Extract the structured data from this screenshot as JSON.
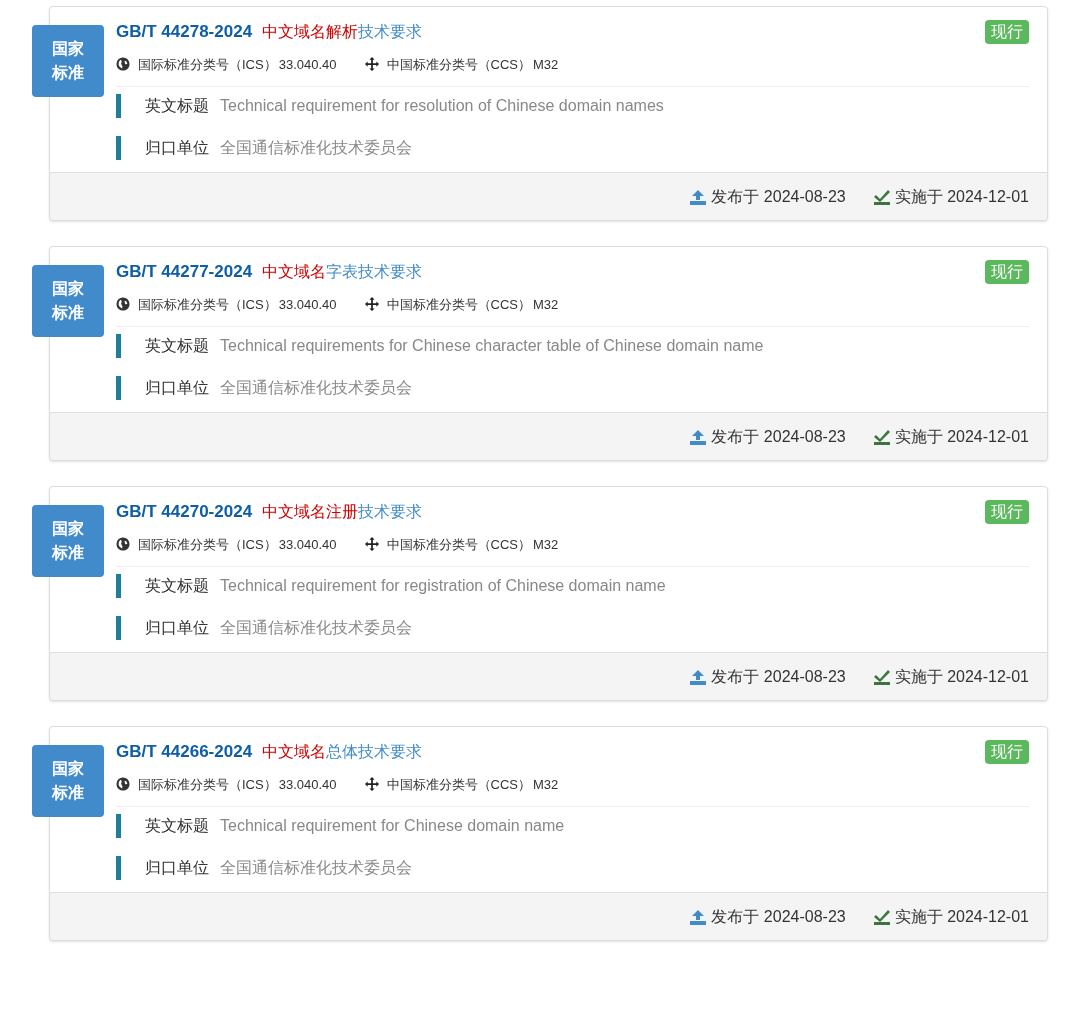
{
  "standards": [
    {
      "badge": [
        "国家",
        "标准"
      ],
      "code": "GB/T 44278-2024",
      "title_highlight": "中文域名解析",
      "title_rest": "技术要求",
      "status": "现行",
      "ics_label": "国际标准分类号（ICS）",
      "ics": "33.040.40",
      "ccs_label": "中国标准分类号（CCS）",
      "ccs": "M32",
      "fields": [
        {
          "label": "英文标题",
          "value": "Technical requirement for resolution of Chinese domain names"
        },
        {
          "label": "归口单位",
          "value": "全国通信标准化技术委员会"
        }
      ],
      "published": "发布于 2024-08-23",
      "effective": "实施于 2024-12-01"
    },
    {
      "badge": [
        "国家",
        "标准"
      ],
      "code": "GB/T 44277-2024",
      "title_highlight": "中文域名",
      "title_rest": "字表技术要求",
      "status": "现行",
      "ics_label": "国际标准分类号（ICS）",
      "ics": "33.040.40",
      "ccs_label": "中国标准分类号（CCS）",
      "ccs": "M32",
      "fields": [
        {
          "label": "英文标题",
          "value": "Technical requirements for Chinese character table of Chinese domain name"
        },
        {
          "label": "归口单位",
          "value": "全国通信标准化技术委员会"
        }
      ],
      "published": "发布于 2024-08-23",
      "effective": "实施于 2024-12-01"
    },
    {
      "badge": [
        "国家",
        "标准"
      ],
      "code": "GB/T 44270-2024",
      "title_highlight": "中文域名注册",
      "title_rest": "技术要求",
      "status": "现行",
      "ics_label": "国际标准分类号（ICS）",
      "ics": "33.040.40",
      "ccs_label": "中国标准分类号（CCS）",
      "ccs": "M32",
      "fields": [
        {
          "label": "英文标题",
          "value": "Technical requirement for registration of Chinese domain name"
        },
        {
          "label": "归口单位",
          "value": "全国通信标准化技术委员会"
        }
      ],
      "published": "发布于 2024-08-23",
      "effective": "实施于 2024-12-01"
    },
    {
      "badge": [
        "国家",
        "标准"
      ],
      "code": "GB/T 44266-2024",
      "title_highlight": "中文域名",
      "title_rest": "总体技术要求",
      "status": "现行",
      "ics_label": "国际标准分类号（ICS）",
      "ics": "33.040.40",
      "ccs_label": "中国标准分类号（CCS）",
      "ccs": "M32",
      "fields": [
        {
          "label": "英文标题",
          "value": "Technical requirement for Chinese domain name"
        },
        {
          "label": "归口单位",
          "value": "全国通信标准化技术委员会"
        }
      ],
      "published": "发布于 2024-08-23",
      "effective": "实施于 2024-12-01"
    }
  ]
}
